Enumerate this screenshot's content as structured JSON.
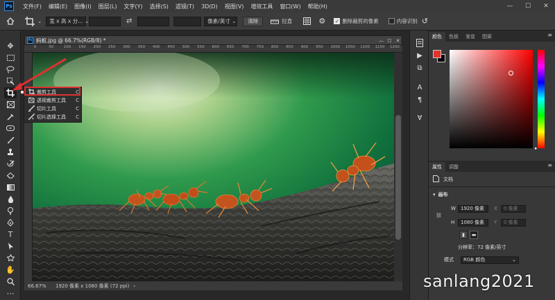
{
  "app": {
    "logo": "Ps"
  },
  "menu": [
    "文件(F)",
    "编辑(E)",
    "图像(I)",
    "图层(L)",
    "文字(Y)",
    "选择(S)",
    "滤镜(T)",
    "3D(D)",
    "视图(V)",
    "增效工具",
    "窗口(W)",
    "帮助(H)"
  ],
  "window_controls": {
    "minimize": "—",
    "maximize": "☐",
    "close": "✕"
  },
  "options": {
    "ratio_select": "宽 x 高 x 分... ⌄",
    "swap_icon": "⇄",
    "unit_select": "像素/英寸 ⌄",
    "clear_button": "清除",
    "straighten_label": "拉直",
    "delete_cropped_label": "删除裁剪的像素",
    "delete_cropped_checked": true,
    "content_aware_label": "内容识别",
    "content_aware_checked": false
  },
  "document": {
    "tab_title": "蚂蚁.jpg @ 66.7%(RGB/8) *",
    "ruler_marks": [
      "0",
      "50",
      "100",
      "150",
      "200",
      "250",
      "300",
      "350",
      "400",
      "450",
      "500",
      "550",
      "600",
      "650",
      "700",
      "750",
      "800",
      "850",
      "900",
      "950",
      "1000",
      "1050",
      "1100",
      "1150",
      "1200"
    ],
    "zoom": "66.67%",
    "status": "1920 像素 x 1080 像素 (72 ppi)"
  },
  "flyout": [
    {
      "label": "裁剪工具",
      "key": "C",
      "icon": "crop-icon"
    },
    {
      "label": "透视裁剪工具",
      "key": "C",
      "icon": "perspective-crop-icon"
    },
    {
      "label": "切片工具",
      "key": "C",
      "icon": "slice-icon"
    },
    {
      "label": "切片选择工具",
      "key": "C",
      "icon": "slice-select-icon"
    }
  ],
  "panels": {
    "color_tabs": [
      "颜色",
      "色板",
      "渐变",
      "图案"
    ],
    "props_tabs": [
      "属性",
      "调整"
    ],
    "doc_label": "文档",
    "canvas_section": "画布",
    "w_label": "W",
    "w_value": "1920 像素",
    "x_label": "X",
    "x_value": "0 像素",
    "h_label": "H",
    "h_value": "1080 像素",
    "y_label": "Y",
    "y_value": "0 像素",
    "resolution": "分辨率：72 像素/英寸",
    "mode_label": "模式",
    "mode_value": "RGB 颜色"
  },
  "colors": {
    "foreground": "#e5322a",
    "background": "#000000",
    "accent_highlight": "#e03030"
  },
  "watermark": "sanlang2021"
}
